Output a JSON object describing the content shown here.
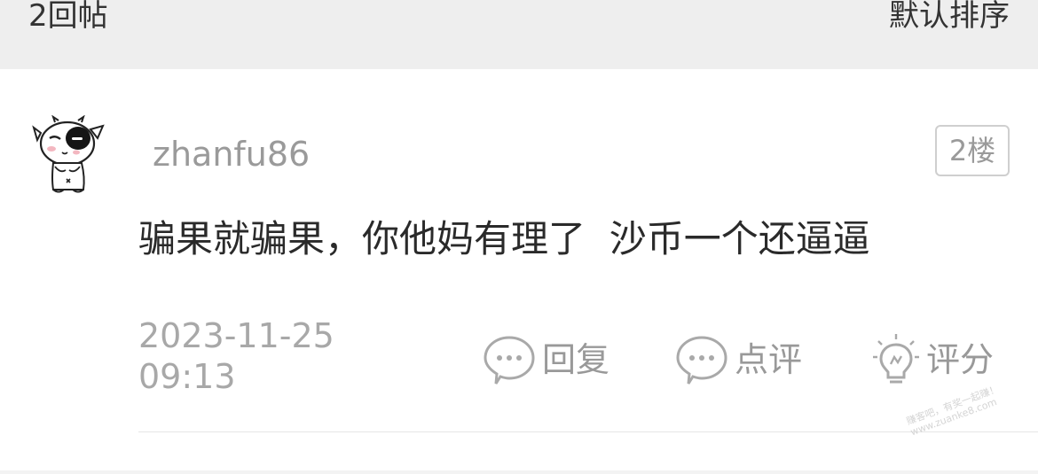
{
  "header": {
    "reply_count": "2回帖",
    "sort_label": "默认排序"
  },
  "post": {
    "username": "zhanfu86",
    "floor": "2楼",
    "body": "骗果就骗果，你他妈有理了  沙币一个还逼逼",
    "timestamp_date": "2023-11-25",
    "timestamp_time": "09:13",
    "actions": {
      "reply": "回复",
      "comment": "点评",
      "rate": "评分"
    }
  },
  "watermark": {
    "line1": "赚客吧，有奖一起赚！",
    "line2": "www.zuanke8.com"
  },
  "colors": {
    "header_bg": "#eeeeee",
    "muted_text": "#9a9a9a",
    "body_text": "#2a2a2a"
  }
}
